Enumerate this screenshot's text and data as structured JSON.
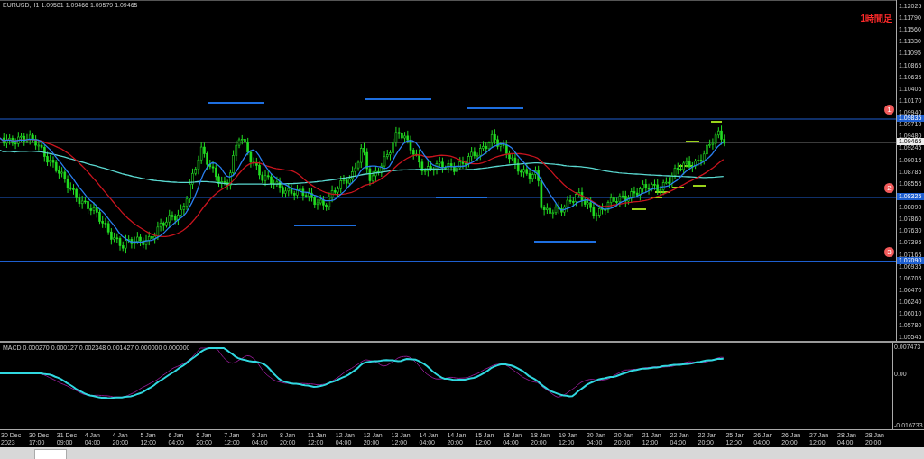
{
  "chart": {
    "header": "EURUSD,H1  1.09581 1.09466 1.09579 1.09465",
    "annotation": "1時間足",
    "levels": [
      {
        "marker": "1",
        "price_label": "1.09835"
      },
      {
        "marker": "2",
        "price_label": "1.08325"
      },
      {
        "marker": "3",
        "price_label": "1.07090"
      }
    ],
    "current_price": "1.09465",
    "price_ticks": [
      "1.12025",
      "1.11790",
      "1.11560",
      "1.11330",
      "1.11095",
      "1.10865",
      "1.10635",
      "1.10405",
      "1.10170",
      "1.09940",
      "1.09710",
      "1.09480",
      "1.09245",
      "1.09015",
      "1.08785",
      "1.08555",
      "1.08090",
      "1.07860",
      "1.07630",
      "1.07395",
      "1.07165",
      "1.06935",
      "1.06705",
      "1.06470",
      "1.06240",
      "1.06010",
      "1.05780",
      "1.05545"
    ]
  },
  "macd": {
    "header": "MACD 0.000270 0.000127 0.002348 0.001427 0.000000 0.000000",
    "ticks": [
      "0.007473",
      "0.00",
      "-0.016733"
    ]
  },
  "time_axis": [
    "30 Dec 2023",
    "30 Dec 17:00",
    "31 Dec 09:00",
    "4 Jan 04:00",
    "4 Jan 20:00",
    "5 Jan 12:00",
    "6 Jan 04:00",
    "6 Jan 20:00",
    "7 Jan 12:00",
    "8 Jan 04:00",
    "8 Jan 20:00",
    "11 Jan 12:00",
    "12 Jan 04:00",
    "12 Jan 20:00",
    "13 Jan 12:00",
    "14 Jan 04:00",
    "14 Jan 20:00",
    "15 Jan 12:00",
    "18 Jan 04:00",
    "18 Jan 20:00",
    "19 Jan 12:00",
    "20 Jan 04:00",
    "20 Jan 20:00",
    "21 Jan 12:00",
    "22 Jan 04:00",
    "22 Jan 20:00",
    "25 Jan 12:00",
    "26 Jan 04:00",
    "26 Jan 20:00",
    "27 Jan 12:00",
    "28 Jan 04:00",
    "28 Jan 20:00"
  ]
}
